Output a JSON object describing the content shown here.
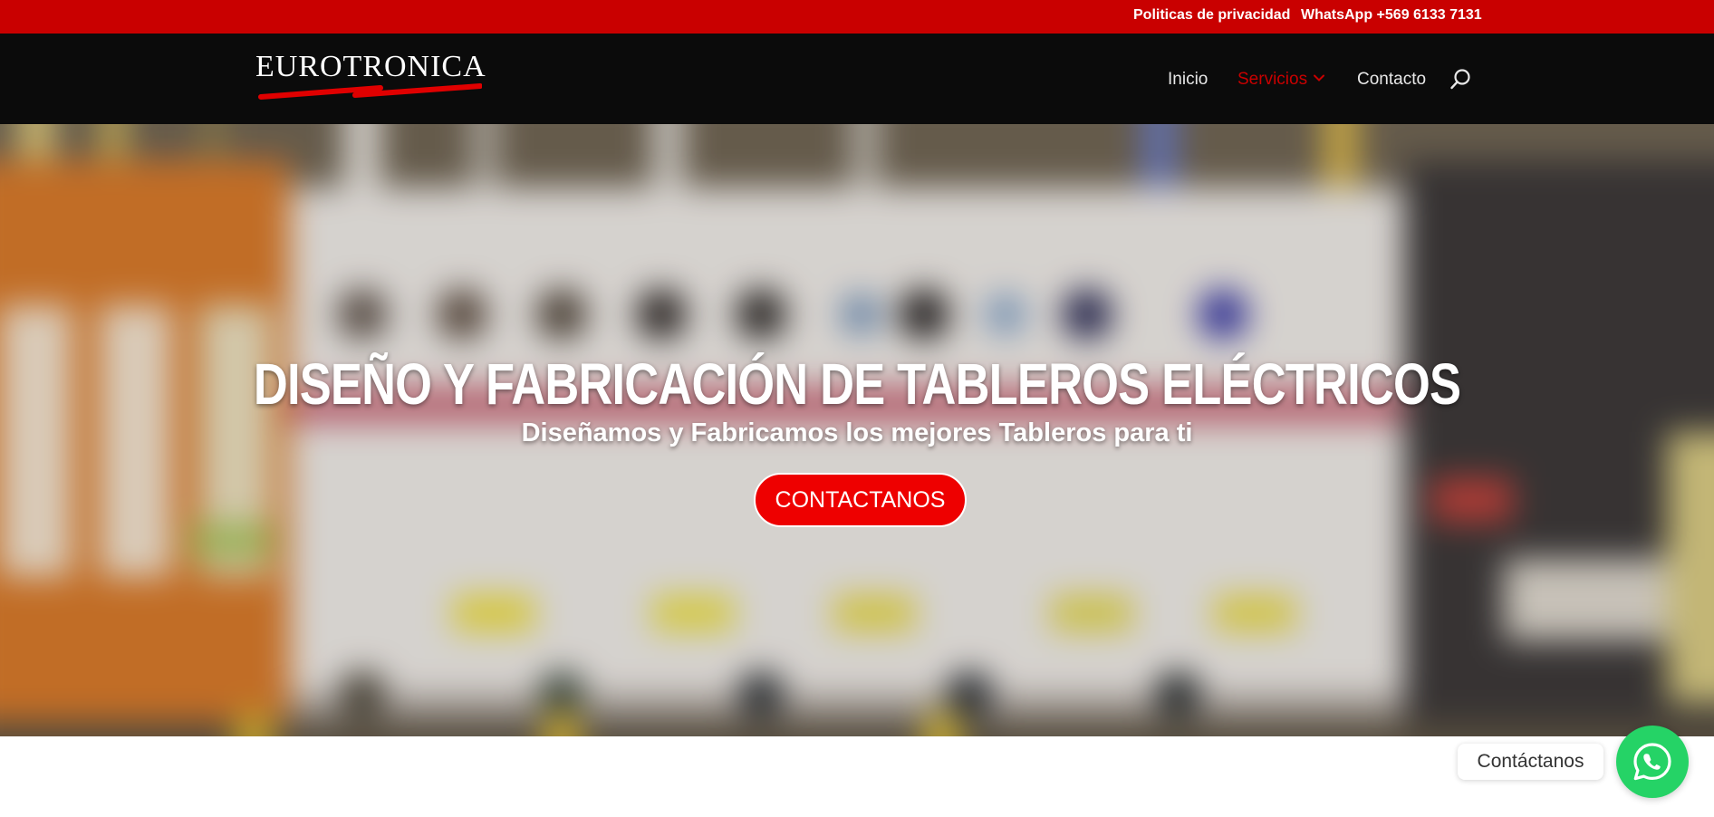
{
  "topbar": {
    "privacy_label": "Politicas de privacidad",
    "whatsapp_label": "WhatsApp +569 6133 7131",
    "color": "#c90000"
  },
  "header": {
    "logo_text": "EUROTRONICA",
    "nav": {
      "inicio": "Inicio",
      "servicios": "Servicios",
      "contacto": "Contacto"
    },
    "active_color": "#c90000",
    "icons": [
      "chevron-down-icon",
      "search-icon"
    ]
  },
  "hero": {
    "title": "DISEÑO Y FABRICACIÓN DE TABLEROS ELÉCTRICOS",
    "subtitle": "Diseñamos y Fabricamos los mejores Tableros para ti",
    "cta_label": "CONTACTANOS",
    "cta_color": "#ee0000"
  },
  "whatsapp_widget": {
    "label": "Contáctanos",
    "icon": "whatsapp-icon",
    "color": "#25d366"
  }
}
